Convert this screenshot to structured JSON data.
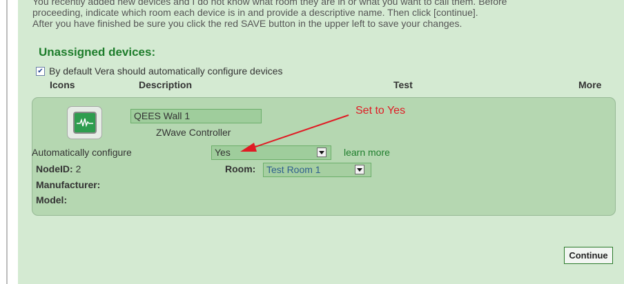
{
  "intro": {
    "line1": "You recently added new devices and I do not know what room they are in or what you want to call them. Before",
    "line2": "proceeding, indicate which room each device is in and provide a descriptive name. Then click [continue].",
    "line3": "After you have finished be sure you click the red SAVE button in the upper left to save your changes."
  },
  "section_title": "Unassigned devices:",
  "auto_default": {
    "checked": true,
    "label": "By default Vera should automatically configure devices"
  },
  "columns": {
    "icons": "Icons",
    "description": "Description",
    "test": "Test",
    "more": "More"
  },
  "device": {
    "name": "QEES Wall 1",
    "type": "ZWave Controller",
    "auto_configure_label": "Automatically configure",
    "auto_configure_value": "Yes",
    "learn_more": "learn more",
    "nodeid_label": "NodeID:",
    "nodeid_value": "2",
    "room_label": "Room:",
    "room_value": "Test Room 1",
    "manufacturer_label": "Manufacturer:",
    "model_label": "Model:"
  },
  "annotation": {
    "text": "Set to Yes",
    "color": "#e01b24"
  },
  "continue_label": "Continue",
  "colors": {
    "panel_bg": "#d4ead2",
    "card_bg": "#b5d7b1",
    "title_green": "#1e7d2c"
  }
}
